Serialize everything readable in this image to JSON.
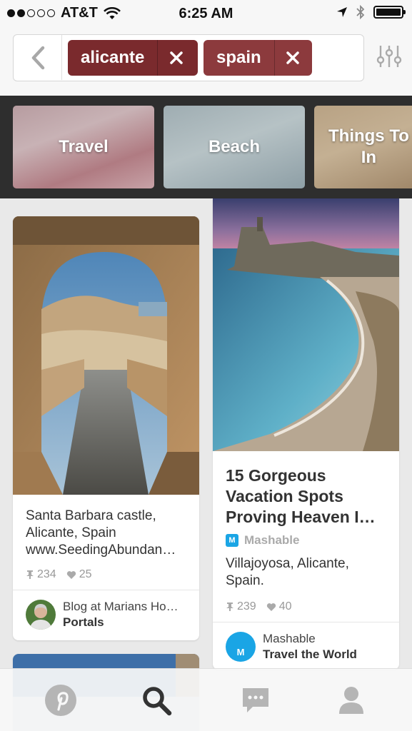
{
  "status_bar": {
    "carrier": "AT&T",
    "time": "6:25 AM",
    "signal_dots_filled": 2,
    "signal_dots_total": 5
  },
  "search": {
    "chips": [
      {
        "label": "alicante",
        "color": "#7a2a2d"
      },
      {
        "label": "spain",
        "color": "#8c3a3d"
      }
    ]
  },
  "categories": [
    {
      "label": "Travel"
    },
    {
      "label": "Beach"
    },
    {
      "label": "Things To\nIn"
    }
  ],
  "pins": [
    {
      "description": "Santa Barbara castle, Alicante, Spain www.SeedingAbundan…",
      "repins": "234",
      "likes": "25",
      "board_owner": "Blog at Marians Ho…",
      "board_name": "Portals"
    },
    {
      "title": "15 Gorgeous Vacation Spots Proving Heaven I…",
      "source": "Mashable",
      "description": "Villajoyosa, Alicante, Spain.",
      "repins": "239",
      "likes": "40",
      "board_owner": "Mashable",
      "board_name": "Travel the World",
      "avatar_letter": "M"
    }
  ],
  "tabs": [
    "home",
    "search",
    "messages",
    "profile"
  ],
  "colors": {
    "chip_dark": "#7a2a2d",
    "chip_light": "#8c3a3d",
    "active_tab": "#333333",
    "inactive_tab": "#b5b5b5",
    "mashable_blue": "#1aa5e5"
  }
}
